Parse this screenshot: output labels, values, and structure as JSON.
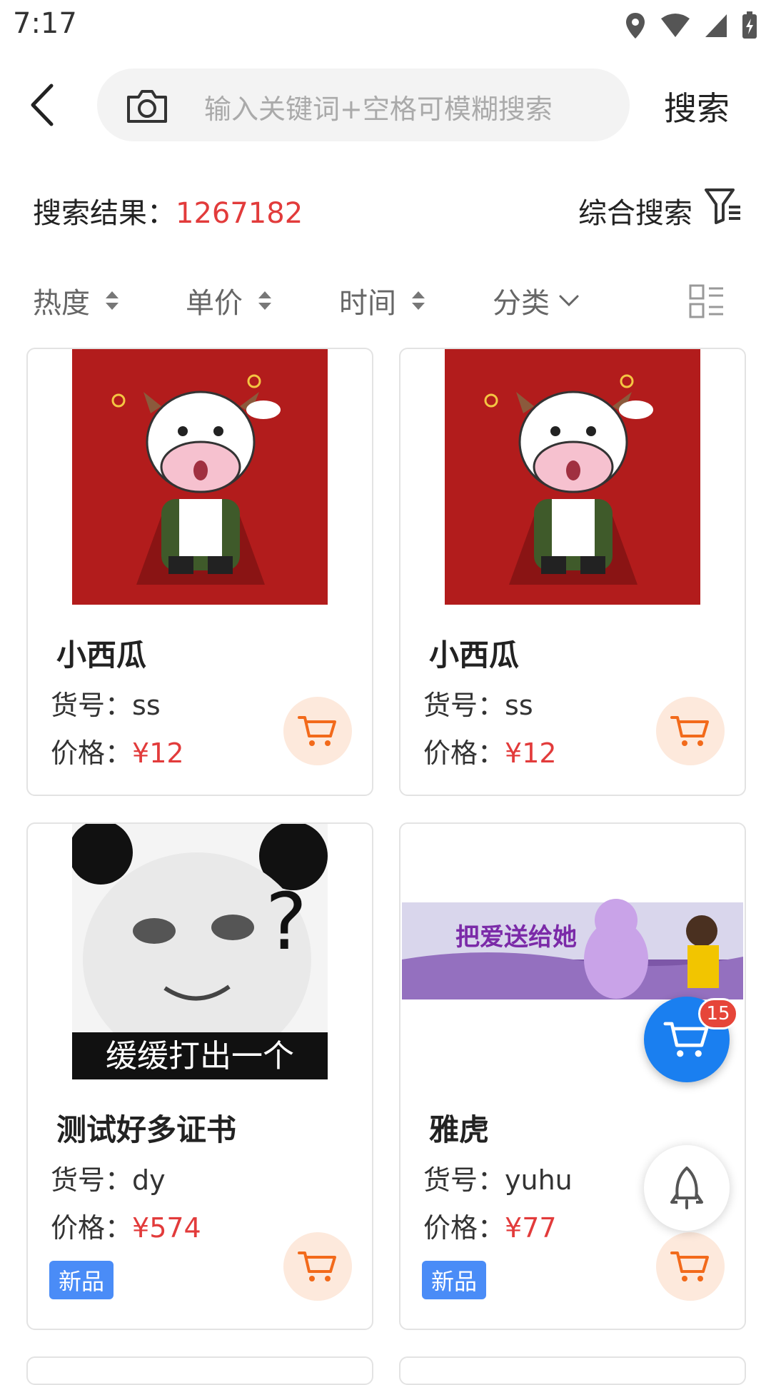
{
  "status": {
    "time": "7:17"
  },
  "search": {
    "placeholder": "输入关键词+空格可模糊搜索",
    "button_label": "搜索"
  },
  "results": {
    "label": "搜索结果：",
    "count": "1267182",
    "sort_label": "综合搜索"
  },
  "tabs": [
    {
      "label": "热度"
    },
    {
      "label": "单价"
    },
    {
      "label": "时间"
    },
    {
      "label": "分类"
    }
  ],
  "products": [
    {
      "name": "小西瓜",
      "sku_label": "货号：",
      "sku": "ss",
      "price_label": "价格：",
      "price": "¥12",
      "badge": "",
      "image": "cartoon-ox-image"
    },
    {
      "name": "小西瓜",
      "sku_label": "货号：",
      "sku": "ss",
      "price_label": "价格：",
      "price": "¥12",
      "badge": "",
      "image": "cartoon-ox-image"
    },
    {
      "name": "测试好多证书",
      "sku_label": "货号：",
      "sku": "dy",
      "price_label": "价格：",
      "price": "¥574",
      "badge": "新品",
      "image": "panda-meme-image",
      "image_text": "缓缓打出一个"
    },
    {
      "name": "雅虎",
      "sku_label": "货号：",
      "sku": "yuhu",
      "price_label": "价格：",
      "price": "¥77",
      "badge": "新品",
      "image": "teddy-bear-banner-image",
      "image_text": "把爱送给她"
    }
  ],
  "floating": {
    "cart_count": "15"
  },
  "colors": {
    "accent_red": "#e23b3b",
    "cart_blue": "#1a7ff0",
    "badge_blue": "#4a8cf7",
    "cart_bg": "#fde9dc",
    "cart_orange": "#f26a1b"
  }
}
